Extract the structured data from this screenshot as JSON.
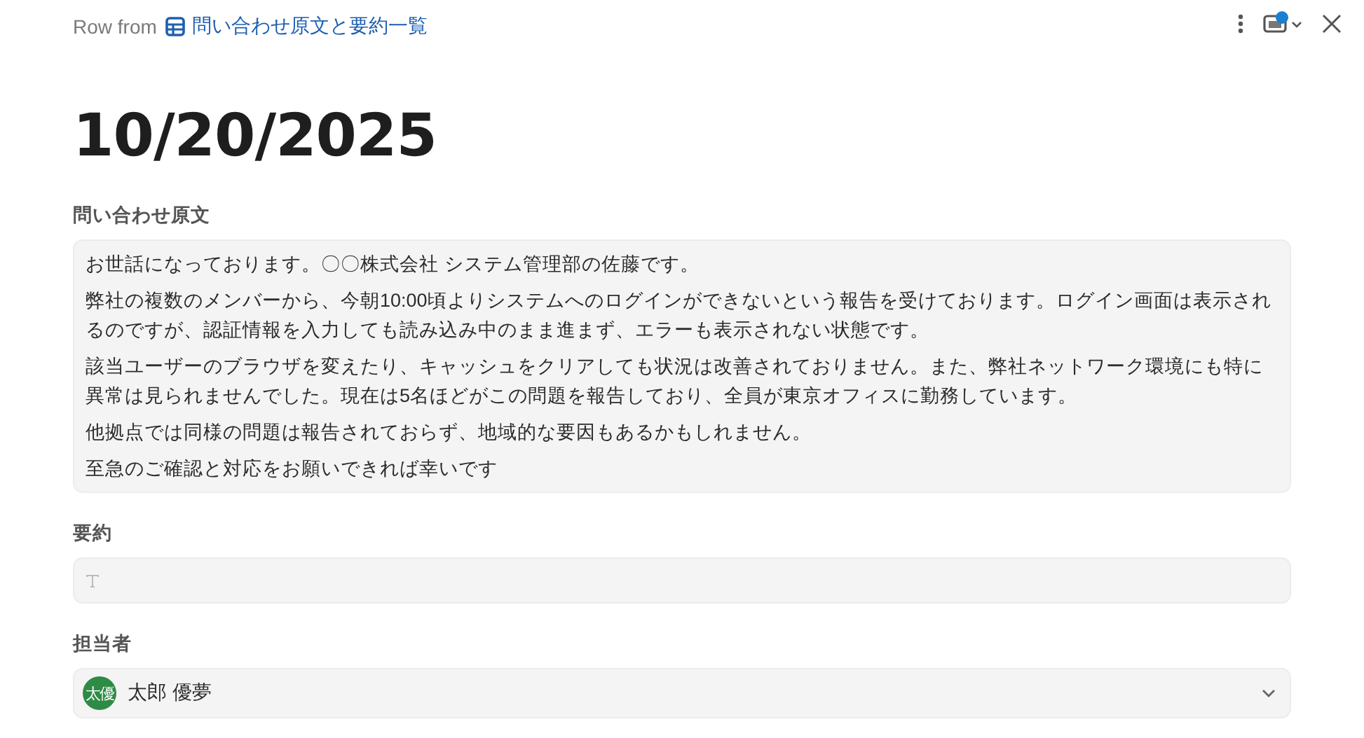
{
  "header": {
    "prefix": "Row from",
    "database": "問い合わせ原文と要約一覧",
    "notification_dot": true
  },
  "title": "10/20/2025",
  "fields": [
    {
      "kind": "longtext",
      "label": "問い合わせ原文",
      "paragraphs": [
        "お世話になっております。〇〇株式会社 システム管理部の佐藤です。",
        "弊社の複数のメンバーから、今朝10:00頃よりシステムへのログインができないという報告を受けております。ログイン画面は表示されるのですが、認証情報を入力しても読み込み中のまま進まず、エラーも表示されない状態です。",
        "該当ユーザーのブラウザを変えたり、キャッシュをクリアしても状況は改善されておりません。また、弊社ネットワーク環境にも特に異常は見られませんでした。現在は5名ほどがこの問題を報告しており、全員が東京オフィスに勤務しています。",
        "他拠点では同様の問題は報告されておらず、地域的な要因もあるかもしれません。",
        "至急のご確認と対応をお願いできれば幸いです"
      ]
    },
    {
      "kind": "empty_text",
      "label": "要約"
    },
    {
      "kind": "person",
      "label": "担当者",
      "person": {
        "initials": "太優",
        "name": "太郎 優夢",
        "color": "#2e8b45"
      }
    }
  ]
}
